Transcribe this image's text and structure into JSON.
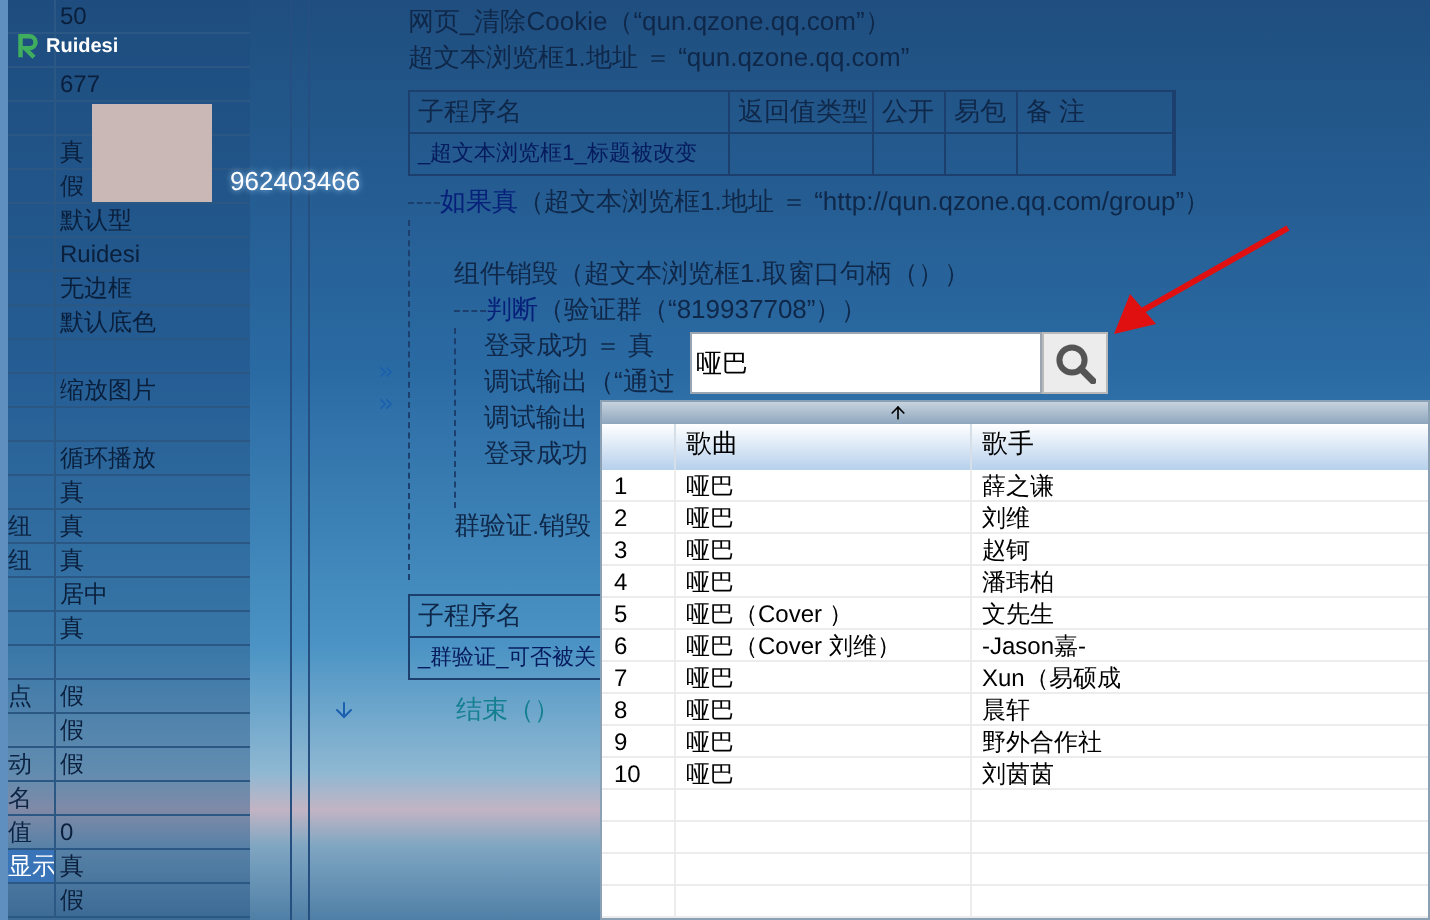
{
  "app": {
    "logo_text": "Ruidesi"
  },
  "profile": {
    "number": "962403466"
  },
  "properties": [
    {
      "value": "50",
      "selected": false
    },
    {
      "selected": false
    },
    {
      "value": "677",
      "selected": false
    },
    {
      "selected": false
    },
    {
      "value": "真",
      "selected": false
    },
    {
      "value": "假",
      "selected": false
    },
    {
      "value": "默认型",
      "selected": false
    },
    {
      "value": "Ruidesi",
      "selected": false
    },
    {
      "value": "无边框",
      "selected": false
    },
    {
      "value": "默认底色",
      "selected": false
    },
    {
      "selected": false
    },
    {
      "value": "缩放图片",
      "selected": false
    },
    {
      "selected": false
    },
    {
      "value": "循环播放",
      "selected": false
    },
    {
      "value": "真",
      "selected": false
    },
    {
      "label": "纽",
      "value": "真",
      "selected": false
    },
    {
      "label": "纽",
      "value": "真",
      "selected": false
    },
    {
      "value": "居中",
      "selected": false
    },
    {
      "value": "真",
      "selected": false
    },
    {
      "selected": false
    },
    {
      "label": "点",
      "value": "假",
      "selected": false
    },
    {
      "value": "假",
      "selected": false
    },
    {
      "label": "动",
      "value": "假",
      "selected": false
    },
    {
      "label": "名",
      "selected": false
    },
    {
      "label": "值",
      "value": "0",
      "selected": false
    },
    {
      "label": "显示",
      "value": "真",
      "selected": true
    },
    {
      "value": "假",
      "selected": false
    }
  ],
  "code": [
    {
      "kind": "line",
      "text": "网页_清除Cookie（“qun.qzone.qq.com”）"
    },
    {
      "kind": "line",
      "text": "超文本浏览框1.地址 ＝ “qun.qzone.qq.com”"
    },
    {
      "kind": "table",
      "columns": [
        "子程序名",
        "返回值类型",
        "公开",
        "易包",
        "备 注"
      ],
      "rows": [
        [
          "_超文本浏览框1_标题被改变"
        ]
      ]
    },
    {
      "kind": "block",
      "keyword": "如果真",
      "text": "（超文本浏览框1.地址 ＝ “http://qun.qzone.qq.com/group”）",
      "children": [
        {
          "kind": "line",
          "text": "组件销毁（超文本浏览框1.取窗口句柄（））"
        },
        {
          "kind": "block",
          "keyword": "判断",
          "text": "（验证群（“819937708”））",
          "children": [
            {
              "kind": "line",
              "text": "登录成功 ＝ 真"
            },
            {
              "kind": "line",
              "text": "调试输出（“通过"
            },
            {
              "kind": "line",
              "text": "调试输出"
            },
            {
              "kind": "line",
              "text": "登录成功"
            }
          ]
        },
        {
          "kind": "line",
          "text": "群验证.销毁"
        }
      ]
    },
    {
      "kind": "table",
      "columns": [
        "子程序名"
      ],
      "rows": [
        [
          "_群验证_可否被关"
        ]
      ]
    },
    {
      "kind": "end",
      "text": "结束（）"
    }
  ],
  "search": {
    "value": "哑巴"
  },
  "results": {
    "columns": [
      "歌曲",
      "歌手"
    ],
    "rows": [
      {
        "number": "1",
        "song": "哑巴",
        "artist": "薛之谦"
      },
      {
        "number": "2",
        "song": "哑巴",
        "artist": "刘维"
      },
      {
        "number": "3",
        "song": "哑巴",
        "artist": "赵钶"
      },
      {
        "number": "4",
        "song": "哑巴",
        "artist": "潘玮柏"
      },
      {
        "number": "5",
        "song": "哑巴（Cover ）",
        "artist": "文先生"
      },
      {
        "number": "6",
        "song": "哑巴（Cover 刘维）",
        "artist": "-Jason嘉-"
      },
      {
        "number": "7",
        "song": "哑巴",
        "artist": "Xun（易硕成"
      },
      {
        "number": "8",
        "song": "哑巴",
        "artist": "晨轩"
      },
      {
        "number": "9",
        "song": "哑巴",
        "artist": "野外合作社"
      },
      {
        "number": "10",
        "song": "哑巴",
        "artist": "刘茵茵"
      }
    ]
  }
}
